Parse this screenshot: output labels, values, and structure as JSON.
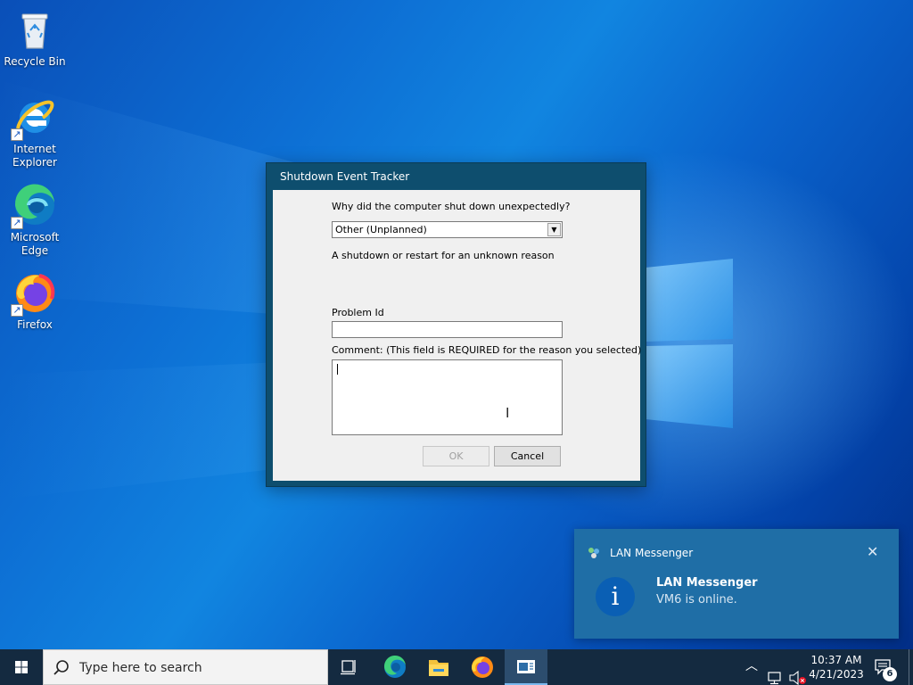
{
  "desktop": {
    "icons": [
      {
        "label": "Recycle Bin",
        "icon": "recycle-bin-icon"
      },
      {
        "label": "Internet Explorer",
        "icon": "internet-explorer-icon"
      },
      {
        "label": "Microsoft Edge",
        "icon": "edge-icon"
      },
      {
        "label": "Firefox",
        "icon": "firefox-icon"
      }
    ]
  },
  "dialog": {
    "title": "Shutdown Event Tracker",
    "question": "Why did the computer shut down unexpectedly?",
    "reason_selected": "Other (Unplanned)",
    "reason_description": "A shutdown or restart for an unknown reason",
    "problem_id_label": "Problem Id",
    "problem_id_value": "",
    "comment_label": "Comment: (This field is REQUIRED for the reason you selected)",
    "comment_value": "",
    "ok_label": "OK",
    "cancel_label": "Cancel"
  },
  "toast": {
    "app_name": "LAN Messenger",
    "title": "LAN Messenger",
    "message": "VM6 is online.",
    "close_icon": "close-icon",
    "info_icon": "i"
  },
  "taskbar": {
    "search_placeholder": "Type here to search",
    "apps": [
      "task-view-icon",
      "edge-icon",
      "file-explorer-icon",
      "firefox-icon",
      "active-window-icon"
    ],
    "clock_time": "10:37 AM",
    "clock_date": "4/21/2023",
    "notification_count": "6"
  },
  "colors": {
    "desktop_blue": "#0d6fd4",
    "dialog_frame": "#0e4e6e",
    "toast_bg": "#1f6ea6",
    "taskbar_bg": "#142a40"
  }
}
